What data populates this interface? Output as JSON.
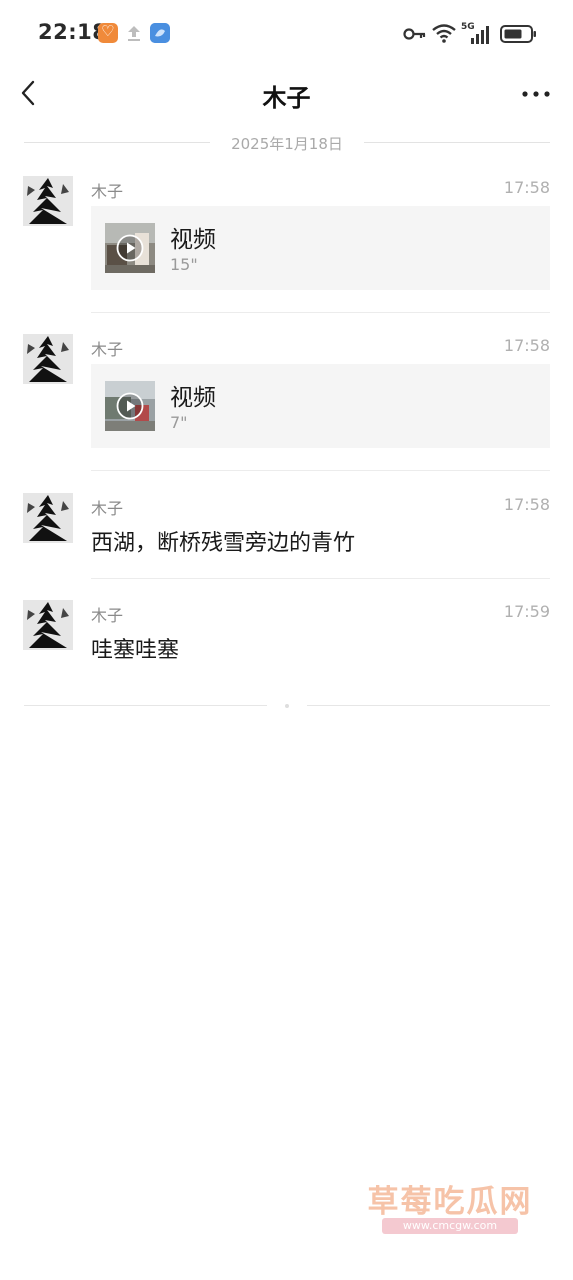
{
  "status_bar": {
    "time": "22:18",
    "icons": [
      "app-badge-icon",
      "upload-icon",
      "app-icon",
      "key-icon",
      "wifi-icon",
      "signal-5g-icon",
      "battery-icon"
    ],
    "network": "5G"
  },
  "header": {
    "title": "木子",
    "back_icon": "chevron-left-icon",
    "more_icon": "more-horizontal-icon"
  },
  "date_divider": "2025年1月18日",
  "messages": [
    {
      "sender": "木子",
      "time": "17:58",
      "type": "video",
      "card_title": "视频",
      "duration": "15\""
    },
    {
      "sender": "木子",
      "time": "17:58",
      "type": "video",
      "card_title": "视频",
      "duration": "7\""
    },
    {
      "sender": "木子",
      "time": "17:58",
      "type": "text",
      "text": "西湖，断桥残雪旁边的青竹"
    },
    {
      "sender": "木子",
      "time": "17:59",
      "type": "text",
      "text": "哇塞哇塞"
    }
  ],
  "watermark": {
    "text": "草莓吃瓜网",
    "url": "www.cmcgw.com"
  },
  "colors": {
    "background": "#ffffff",
    "card_bg": "#f5f5f5",
    "muted_text": "#8a8a8a",
    "watermark": "#f6c3a8"
  }
}
